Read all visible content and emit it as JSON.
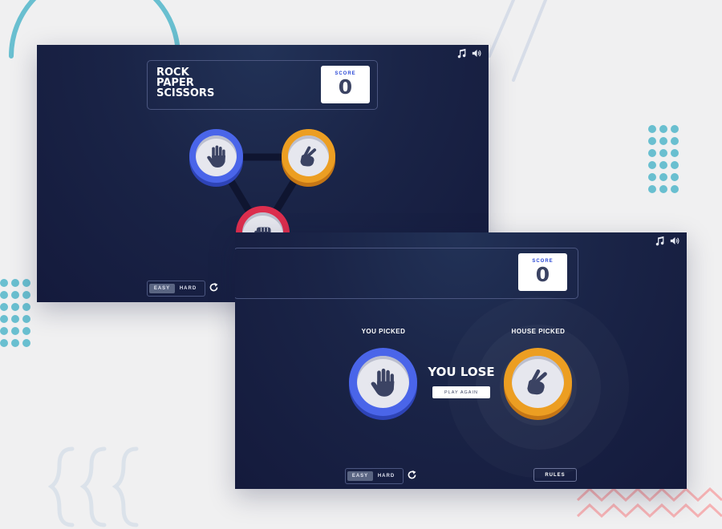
{
  "game": {
    "title": "ROCK\nPAPER\nSCISSORS",
    "score_label": "SCORE",
    "score_value": "0"
  },
  "mode_toggle": {
    "options": [
      "EASY",
      "HARD"
    ],
    "selected": "EASY"
  },
  "rules_label": "RULES",
  "result_screen": {
    "you_picked_label": "YOU PICKED",
    "house_picked_label": "HOUSE PICKED",
    "result": "YOU LOSE",
    "play_again_label": "PLAY AGAIN",
    "player_choice": "paper",
    "house_choice": "scissors"
  },
  "icons": {
    "music": "music-icon",
    "sound": "speaker-icon",
    "refresh": "refresh-icon",
    "paper": "hand-paper-icon",
    "scissors": "hand-scissors-icon",
    "rock": "hand-rock-icon"
  },
  "colors": {
    "paper": "#4a65e9",
    "scissors": "#ec9e22",
    "rock": "#dc2e4e",
    "background": "#1a2447",
    "score_accent": "#2b49d6"
  }
}
